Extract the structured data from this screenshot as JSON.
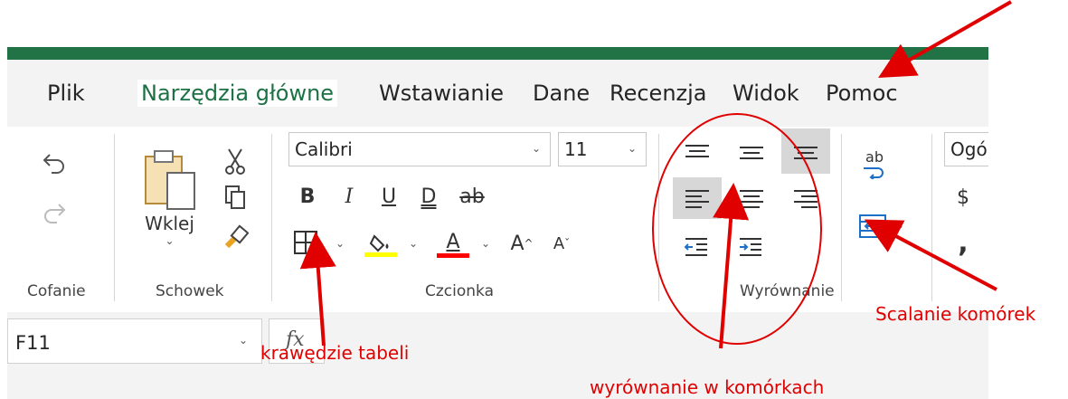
{
  "tabs": {
    "file": "Plik",
    "home": "Narzędzia główne",
    "insert": "Wstawianie",
    "data": "Dane",
    "review": "Recenzja",
    "view": "Widok",
    "help": "Pomoc"
  },
  "groups": {
    "undo": "Cofanie",
    "clipboard": "Schowek",
    "font": "Czcionka",
    "alignment": "Wyrównanie"
  },
  "clipboard": {
    "paste_label": "Wklej"
  },
  "font": {
    "name": "Calibri",
    "size": "11",
    "bold": "B",
    "italic": "I",
    "underline": "U",
    "double_underline": "D",
    "strike": "ab",
    "font_color_letter": "A",
    "grow": "A",
    "shrink": "A"
  },
  "wrap": {
    "label": "ab"
  },
  "number": {
    "format": "Ogó",
    "currency": "$"
  },
  "formula_bar": {
    "cell_ref": "F11",
    "fx": "fx"
  },
  "annotations": {
    "borders": "krawędzie tabeli",
    "alignment": "wyrównanie w komórkach",
    "merge": "Scalanie komórek"
  },
  "colors": {
    "excel_green": "#217346",
    "active_tab_text": "#1e7145",
    "highlight_yellow": "#ffff00",
    "font_red": "#ff0000",
    "annotation_red": "#e00000"
  }
}
